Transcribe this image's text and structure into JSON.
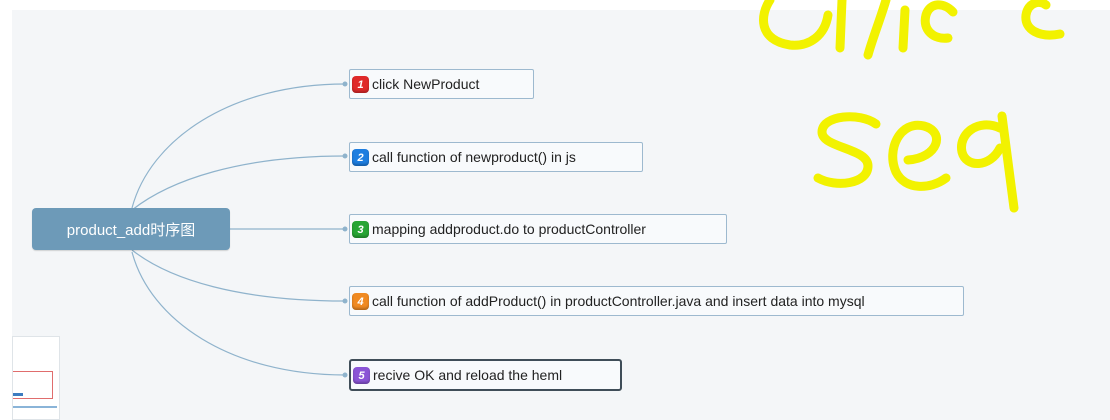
{
  "root": {
    "label": "product_add时序图"
  },
  "nodes": [
    {
      "num": "1",
      "label": "click NewProduct",
      "color": "#e02a2a",
      "selected": false
    },
    {
      "num": "2",
      "label": "call function of newproduct() in js",
      "color": "#1e7ee0",
      "selected": false
    },
    {
      "num": "3",
      "label": "mapping addproduct.do to productController",
      "color": "#27a534",
      "selected": false
    },
    {
      "num": "4",
      "label": "call function of addProduct() in productController.java and insert data into mysql",
      "color": "#f08a22",
      "selected": false
    },
    {
      "num": "5",
      "label": "recive OK and reload the heml",
      "color": "#8b55d6",
      "selected": true
    }
  ],
  "colors": {
    "connector": "#8fb3cc",
    "root_bg": "#6d9ab8",
    "ink": "#f2f200"
  }
}
